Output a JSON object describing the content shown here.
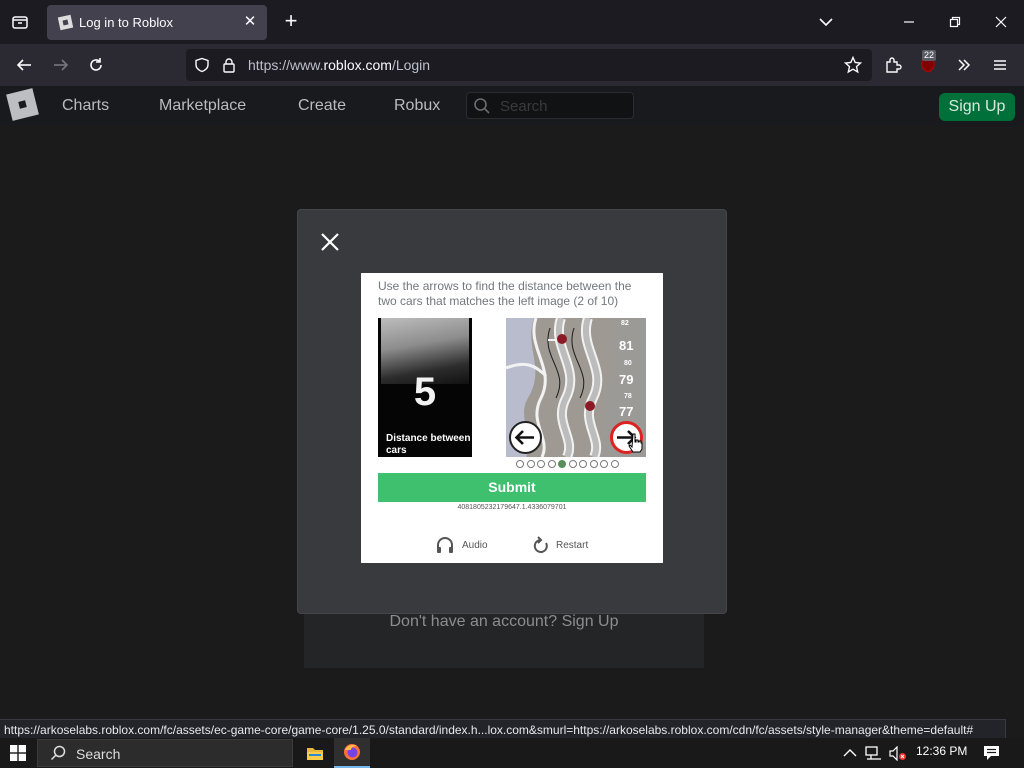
{
  "browser": {
    "tab_title": "Log in to Roblox",
    "url_prefix": "https://www.",
    "url_domain": "roblox.com",
    "url_path": "/Login",
    "extension_badge": "22"
  },
  "roblox_header": {
    "nav_items": [
      "Charts",
      "Marketplace",
      "Create",
      "Robux"
    ],
    "search_placeholder": "Search",
    "signup_label": "Sign Up"
  },
  "page": {
    "no_account_text": "Don't have an account? Sign Up"
  },
  "captcha": {
    "instruction": "Use the arrows to find the distance between the two cars that matches the left image (2 of 10)",
    "reference_number": "5",
    "reference_caption": "Distance between cars",
    "track_numbers": [
      "82",
      "81",
      "80",
      "79",
      "78",
      "77"
    ],
    "progress": {
      "total": 10,
      "current": 5
    },
    "submit_label": "Submit",
    "session_id": "4081805232179647.1.4336079701",
    "audio_label": "Audio",
    "restart_label": "Restart"
  },
  "statusbar": {
    "link_text": "https://arkoselabs.roblox.com/fc/assets/ec-game-core/game-core/1.25.0/standard/index.h...lox.com&smurl=https://arkoselabs.roblox.com/cdn/fc/assets/style-manager&theme=default#"
  },
  "taskbar": {
    "search_label": "Search",
    "time": "12:36 PM"
  },
  "colors": {
    "submit_green": "#3ec06e",
    "signup_green": "#00703a",
    "modal_bg": "#393a3d"
  }
}
